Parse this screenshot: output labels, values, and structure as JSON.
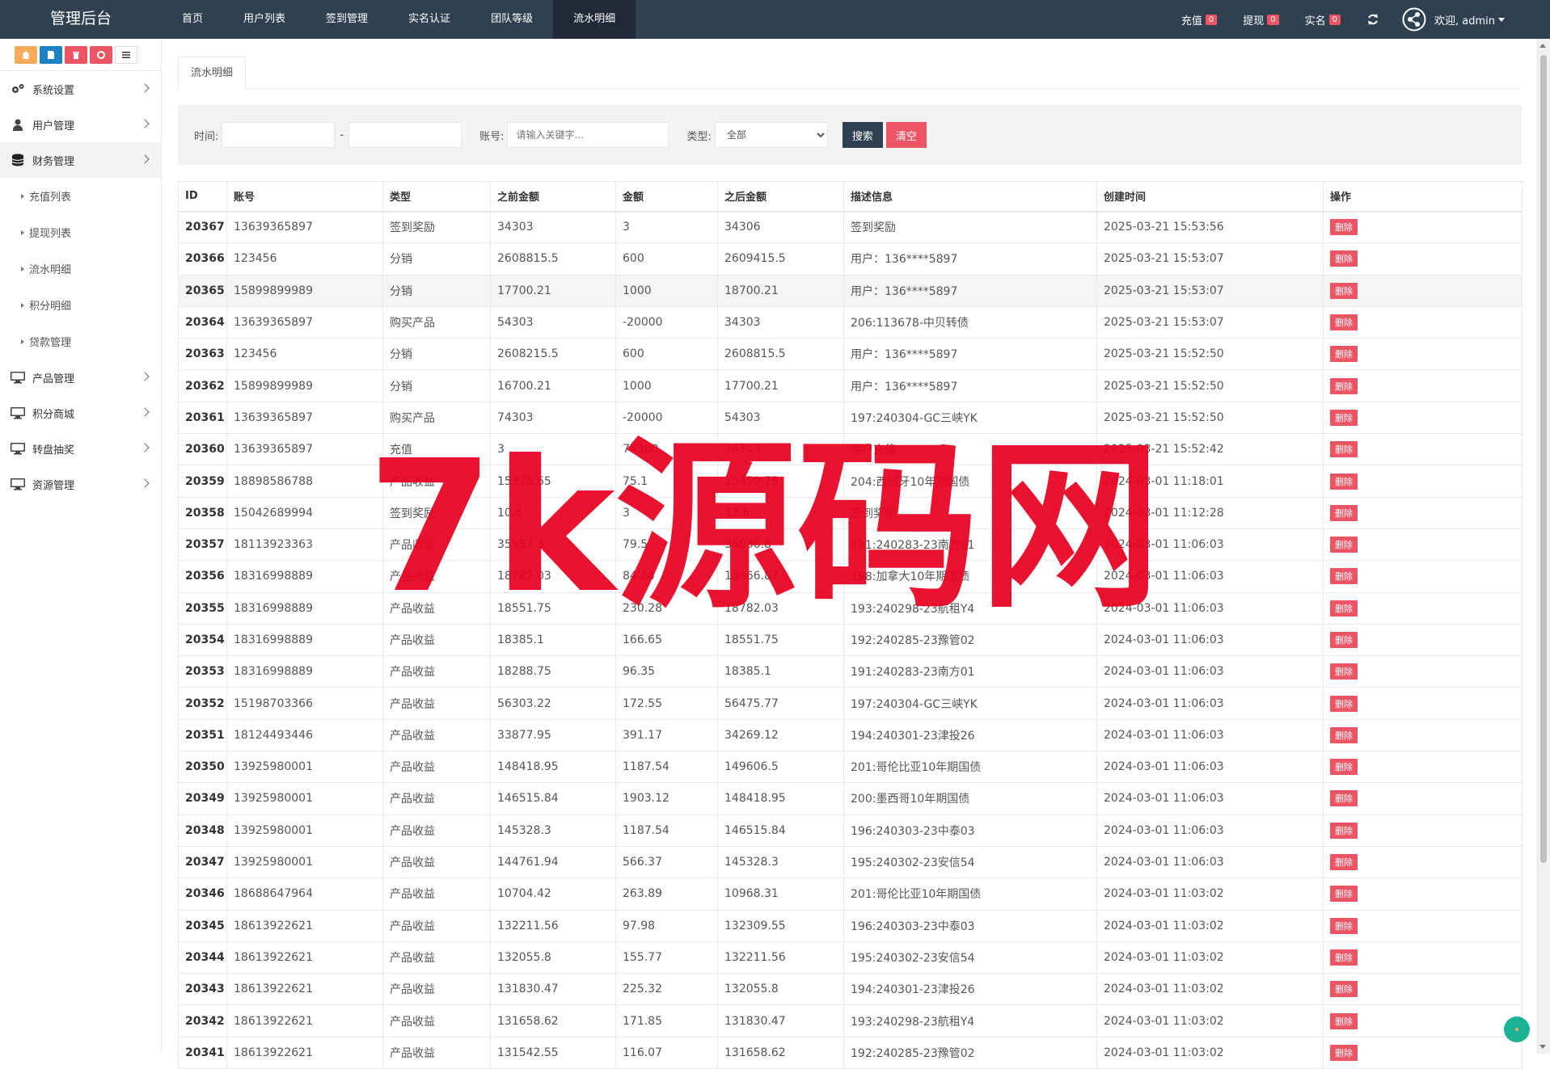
{
  "brand": "管理后台",
  "topnav": [
    "首页",
    "用户列表",
    "签到管理",
    "实名认证",
    "团队等级",
    "流水明细"
  ],
  "topright": {
    "recharge": {
      "label": "充值",
      "count": "0"
    },
    "withdraw": {
      "label": "提现",
      "count": "0"
    },
    "realname": {
      "label": "实名",
      "count": "0"
    },
    "welcome": "欢迎, admin"
  },
  "sidebar": {
    "menu": [
      "系统设置",
      "用户管理",
      "财务管理"
    ],
    "finance_sub": [
      "充值列表",
      "提现列表",
      "流水明细",
      "积分明细",
      "贷款管理"
    ],
    "menu2": [
      "产品管理",
      "积分商城",
      "转盘抽奖",
      "资源管理"
    ]
  },
  "tab": "流水明细",
  "filter": {
    "time_label": "时间:",
    "dash": "-",
    "account_label": "账号:",
    "account_placeholder": "请输入关键字...",
    "type_label": "类型:",
    "type_selected": "全部",
    "search_btn": "搜索",
    "clear_btn": "清空"
  },
  "table": {
    "headers": [
      "ID",
      "账号",
      "类型",
      "之前金额",
      "金额",
      "之后金额",
      "描述信息",
      "创建时间",
      "操作"
    ],
    "delete_label": "删除",
    "rows": [
      [
        "20367",
        "13639365897",
        "签到奖励",
        "34303",
        "3",
        "34306",
        "签到奖励",
        "2025-03-21 15:53:56"
      ],
      [
        "20366",
        "123456",
        "分销",
        "2608815.5",
        "600",
        "2609415.5",
        "用户：136****5897",
        "2025-03-21 15:53:07"
      ],
      [
        "20365",
        "15899899989",
        "分销",
        "17700.21",
        "1000",
        "18700.21",
        "用户：136****5897",
        "2025-03-21 15:53:07"
      ],
      [
        "20364",
        "13639365897",
        "购买产品",
        "54303",
        "-20000",
        "34303",
        "206:113678-中贝转债",
        "2025-03-21 15:53:07"
      ],
      [
        "20363",
        "123456",
        "分销",
        "2608215.5",
        "600",
        "2608815.5",
        "用户：136****5897",
        "2025-03-21 15:52:50"
      ],
      [
        "20362",
        "15899899989",
        "分销",
        "16700.21",
        "1000",
        "17700.21",
        "用户：136****5897",
        "2025-03-21 15:52:50"
      ],
      [
        "20361",
        "13639365897",
        "购买产品",
        "74303",
        "-20000",
        "54303",
        "197:240304-GC三峡YK",
        "2025-03-21 15:52:50"
      ],
      [
        "20360",
        "13639365897",
        "充值",
        "3",
        "74300",
        "74303",
        "用户充值",
        "2025-03-21 15:52:42"
      ],
      [
        "20359",
        "18898586788",
        "产品收益",
        "15375.65",
        "75.1",
        "15450.75",
        "204:西班牙10年期国债",
        "2024-03-01 11:18:01"
      ],
      [
        "20358",
        "15042689994",
        "签到奖励",
        "10.6",
        "3",
        "13.6",
        "签到奖励",
        "2024-03-01 11:12:28"
      ],
      [
        "20357",
        "18113923363",
        "产品收益",
        "35957.3",
        "79.5",
        "36036.8",
        "191:240283-23南方01",
        "2024-03-01 11:06:03"
      ],
      [
        "20356",
        "18316998889",
        "产品收益",
        "18782.03",
        "84.84",
        "18866.87",
        "198:加拿大10年期国债",
        "2024-03-01 11:06:03"
      ],
      [
        "20355",
        "18316998889",
        "产品收益",
        "18551.75",
        "230.28",
        "18782.03",
        "193:240298-23航租Y4",
        "2024-03-01 11:06:03"
      ],
      [
        "20354",
        "18316998889",
        "产品收益",
        "18385.1",
        "166.65",
        "18551.75",
        "192:240285-23豫管02",
        "2024-03-01 11:06:03"
      ],
      [
        "20353",
        "18316998889",
        "产品收益",
        "18288.75",
        "96.35",
        "18385.1",
        "191:240283-23南方01",
        "2024-03-01 11:06:03"
      ],
      [
        "20352",
        "15198703366",
        "产品收益",
        "56303.22",
        "172.55",
        "56475.77",
        "197:240304-GC三峡YK",
        "2024-03-01 11:06:03"
      ],
      [
        "20351",
        "18124493446",
        "产品收益",
        "33877.95",
        "391.17",
        "34269.12",
        "194:240301-23津投26",
        "2024-03-01 11:06:03"
      ],
      [
        "20350",
        "13925980001",
        "产品收益",
        "148418.95",
        "1187.54",
        "149606.5",
        "201:哥伦比亚10年期国债",
        "2024-03-01 11:06:03"
      ],
      [
        "20349",
        "13925980001",
        "产品收益",
        "146515.84",
        "1903.12",
        "148418.95",
        "200:墨西哥10年期国债",
        "2024-03-01 11:06:03"
      ],
      [
        "20348",
        "13925980001",
        "产品收益",
        "145328.3",
        "1187.54",
        "146515.84",
        "196:240303-23中泰03",
        "2024-03-01 11:06:03"
      ],
      [
        "20347",
        "13925980001",
        "产品收益",
        "144761.94",
        "566.37",
        "145328.3",
        "195:240302-23安信54",
        "2024-03-01 11:06:03"
      ],
      [
        "20346",
        "18688647964",
        "产品收益",
        "10704.42",
        "263.89",
        "10968.31",
        "201:哥伦比亚10年期国债",
        "2024-03-01 11:03:02"
      ],
      [
        "20345",
        "18613922621",
        "产品收益",
        "132211.56",
        "97.98",
        "132309.55",
        "196:240303-23中泰03",
        "2024-03-01 11:03:02"
      ],
      [
        "20344",
        "18613922621",
        "产品收益",
        "132055.8",
        "155.77",
        "132211.56",
        "195:240302-23安信54",
        "2024-03-01 11:03:02"
      ],
      [
        "20343",
        "18613922621",
        "产品收益",
        "131830.47",
        "225.32",
        "132055.8",
        "194:240301-23津投26",
        "2024-03-01 11:03:02"
      ],
      [
        "20342",
        "18613922621",
        "产品收益",
        "131658.62",
        "171.85",
        "131830.47",
        "193:240298-23航租Y4",
        "2024-03-01 11:03:02"
      ],
      [
        "20341",
        "18613922621",
        "产品收益",
        "131542.55",
        "116.07",
        "131658.62",
        "192:240285-23豫管02",
        "2024-03-01 11:03:02"
      ]
    ]
  },
  "watermark": "7k源码网",
  "colors": {
    "nav": "#2f4050",
    "danger": "#ed5565",
    "warning": "#f8ac59",
    "primary": "#1c84c6",
    "accent": "#1ab394",
    "watermark": "#e8001e"
  }
}
